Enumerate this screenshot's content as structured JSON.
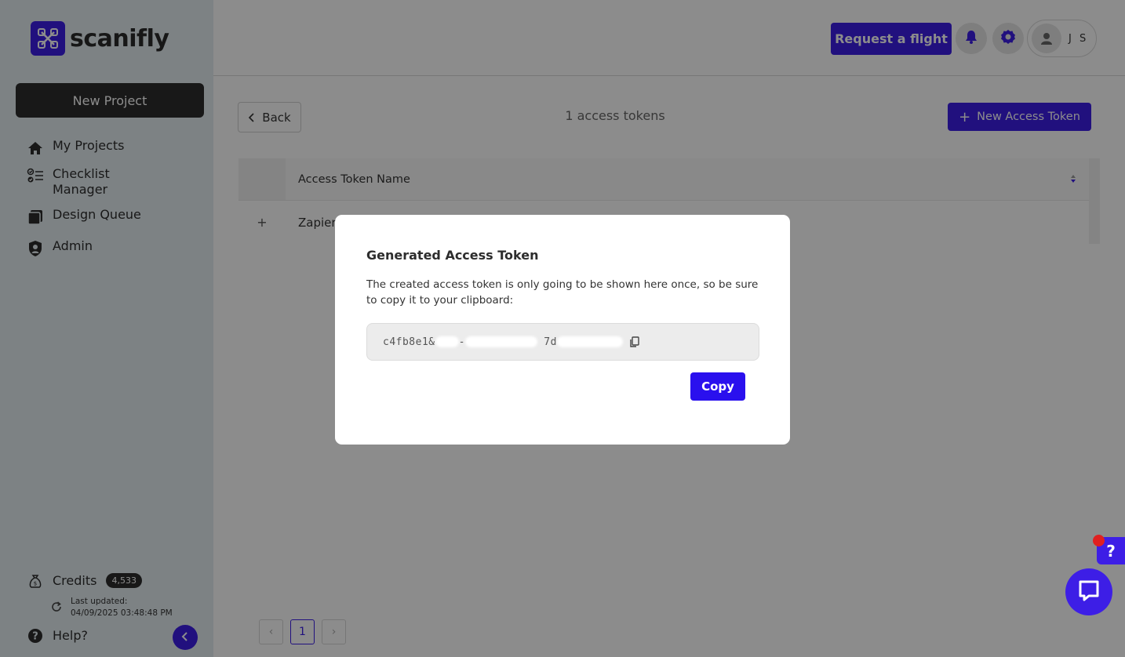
{
  "brand": {
    "name": "scanifly"
  },
  "sidebar": {
    "new_project": "New Project",
    "items": [
      {
        "label": "My Projects",
        "icon": "home-icon"
      },
      {
        "label": "Checklist Manager",
        "icon": "checklist-icon"
      },
      {
        "label": "Design Queue",
        "icon": "layers-icon"
      },
      {
        "label": "Admin",
        "icon": "shield-user-icon"
      }
    ],
    "credits": {
      "label": "Credits",
      "count": "4,533"
    },
    "last_updated": {
      "label": "Last updated:",
      "value": "04/09/2025 03:48:48 PM"
    },
    "help": "Help?"
  },
  "header": {
    "request_flight": "Request a flight",
    "user_initials": "J S"
  },
  "main": {
    "back": "Back",
    "count_text": "1 access tokens",
    "new_token": "New Access Token",
    "table": {
      "column": "Access Token Name",
      "rows": [
        {
          "name": "Zapier"
        }
      ]
    },
    "pagination": {
      "current": "1",
      "prev": "‹",
      "next": "›"
    }
  },
  "modal": {
    "title": "Generated Access Token",
    "description": "The created access token is only going to be shown here once, so be sure to copy it to your clipboard:",
    "token_parts": [
      "c4fb8e1&",
      "7d"
    ],
    "copy": "Copy"
  },
  "colors": {
    "accent": "#3d1ee6",
    "sidebar_bg": "#e4edf1",
    "dark": "#2d2d2d",
    "notification": "#e02020"
  },
  "widgets": {
    "help_fab": "?"
  }
}
